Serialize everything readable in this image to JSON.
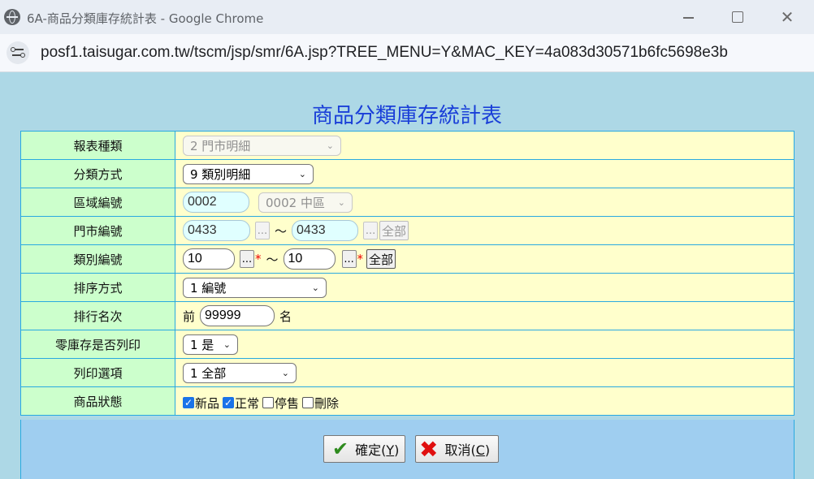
{
  "window": {
    "title": "6A-商品分類庫存統計表 - Google Chrome",
    "url": "posf1.taisugar.com.tw/tscm/jsp/smr/6A.jsp?TREE_MENU=Y&MAC_KEY=4a083d30571b6fc5698e3b"
  },
  "page": {
    "title": "商品分類庫存統計表"
  },
  "form": {
    "report_type": {
      "label": "報表種類",
      "value": "2 門市明細"
    },
    "classify_method": {
      "label": "分類方式",
      "value": "9 類別明細"
    },
    "region_code": {
      "label": "區域編號",
      "input": "0002",
      "select": "0002 中區"
    },
    "store_code": {
      "label": "門市編號",
      "from": "0433",
      "to": "0433",
      "dots": "...",
      "tilde": "～",
      "all": "全部"
    },
    "category_code": {
      "label": "類別編號",
      "from": "10",
      "to": "10",
      "dots": "...",
      "required": "*",
      "tilde": "～",
      "all": "全部"
    },
    "sort_method": {
      "label": "排序方式",
      "value": "1 編號"
    },
    "rank": {
      "label": "排行名次",
      "prefix": "前",
      "value": "99999",
      "suffix": "名"
    },
    "print_zero": {
      "label": "零庫存是否列印",
      "value": "1 是"
    },
    "print_option": {
      "label": "列印選項",
      "value": "1 全部"
    },
    "product_status": {
      "label": "商品狀態",
      "options": [
        {
          "label": "新品",
          "checked": true
        },
        {
          "label": "正常",
          "checked": true
        },
        {
          "label": "停售",
          "checked": false
        },
        {
          "label": "刪除",
          "checked": false
        }
      ]
    }
  },
  "actions": {
    "confirm": {
      "text": "確定(",
      "key": "Y",
      "close": ")"
    },
    "cancel": {
      "text": "取消(",
      "key": "C",
      "close": ")"
    }
  },
  "colors": {
    "page_bg": "#add8e6",
    "label_bg": "#ccffcc",
    "value_bg": "#ffffcc",
    "border": "#29a9e0",
    "title": "#1a3fd8",
    "button_area": "#9fcef0"
  }
}
